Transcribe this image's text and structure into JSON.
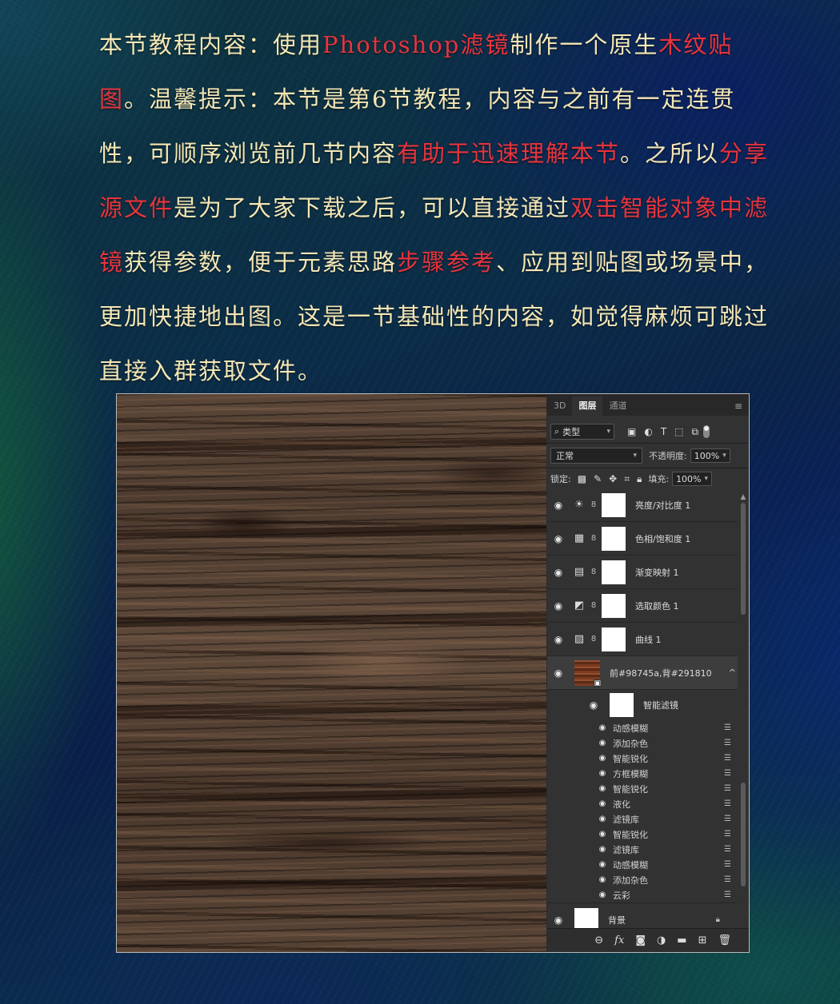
{
  "intro": {
    "p1": "本节教程内容：使用",
    "h1": "Photoshop滤镜",
    "p2": "制作一个原生",
    "h2": "木纹贴图",
    "p3": "。温馨提示：本节是第6节教程，内容与之前有一定连贯性，可顺序浏览前几节内容",
    "h3": "有助于迅速理解本节",
    "p4": "。之所以",
    "h4": "分享源文件",
    "p5": "是为了大家下载之后，可以直接通过",
    "h5": "双击智能对象中滤镜",
    "p6": "获得参数，便于元素思路",
    "h6": "步骤参考",
    "p7": "、应用到贴图或场景中，更加快捷地出图。这是一节基础性的内容，如觉得麻烦可跳过直接入群获取文件。"
  },
  "colors": {
    "highlight": "#e8343c",
    "text": "#f4e7b5",
    "panel": "#323232"
  },
  "panel": {
    "tabs": [
      "3D",
      "图层",
      "通道"
    ],
    "active_tab": "图层",
    "menu_icon": "≡",
    "filter_kind": "类型",
    "blend_mode": "正常",
    "opacity_label": "不透明度:",
    "opacity_value": "100%",
    "lock_label": "锁定:",
    "fill_label": "填充:",
    "fill_value": "100%",
    "layers": [
      {
        "icon": "brightness-icon",
        "glyph": "☀",
        "name": "亮度/对比度 1"
      },
      {
        "icon": "hue-saturation-icon",
        "glyph": "▦",
        "name": "色相/饱和度 1"
      },
      {
        "icon": "gradient-map-icon",
        "glyph": "▤",
        "name": "渐变映射 1"
      },
      {
        "icon": "selective-color-icon",
        "glyph": "◩",
        "name": "选取颜色 1"
      },
      {
        "icon": "curves-icon",
        "glyph": "▨",
        "name": "曲线 1"
      }
    ],
    "smart_layer": {
      "name": "前#98745a,背#291810",
      "expand": "^"
    },
    "smart_filters_label": "智能滤镜",
    "filters": [
      "动感模糊",
      "添加杂色",
      "智能锐化",
      "方框模糊",
      "智能锐化",
      "液化",
      "滤镜库",
      "智能锐化",
      "滤镜库",
      "动感模糊",
      "添加杂色",
      "云彩"
    ],
    "background_layer": "背景",
    "bottom_icons": [
      "link-icon",
      "fx-icon",
      "mask-icon",
      "adjustment-icon",
      "folder-icon",
      "new-layer-icon",
      "trash-icon"
    ]
  }
}
